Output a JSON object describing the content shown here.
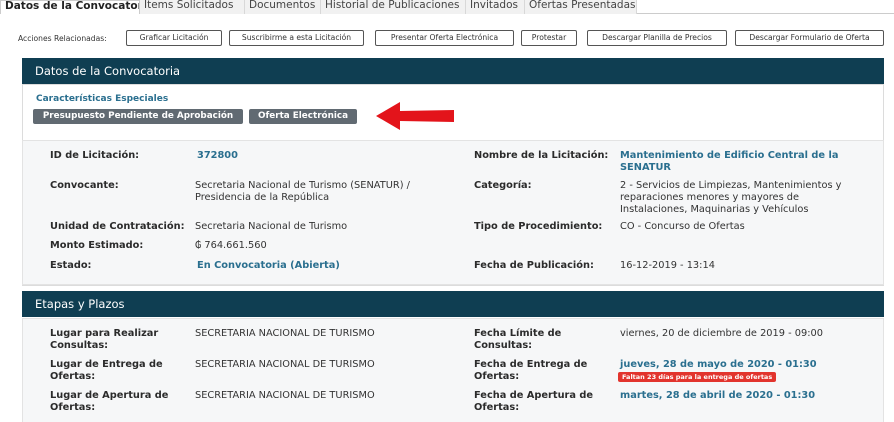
{
  "tabs": [
    {
      "label": "Datos de la Convocatoria",
      "active": true
    },
    {
      "label": "Ítems Solicitados"
    },
    {
      "label": "Documentos"
    },
    {
      "label": "Historial de Publicaciones"
    },
    {
      "label": "Invitados"
    },
    {
      "label": "Ofertas Presentadas"
    }
  ],
  "actions": {
    "label": "Acciones Relacionadas:",
    "buttons": [
      "Graficar Licitación",
      "Suscribirme a esta Licitación",
      "Presentar Oferta Electrónica",
      "Protestar",
      "Descargar Planilla de Precios",
      "Descargar Formulario de Oferta"
    ]
  },
  "convocatoria": {
    "header": "Datos de la Convocatoria",
    "special_title": "Características Especiales",
    "badges": [
      "Presupuesto Pendiente de Aprobación",
      "Oferta Electrónica"
    ],
    "arrow_color": "#e3141b"
  },
  "info": {
    "id_label": "ID de Licitación:",
    "id_value": "372800",
    "nombre_label": "Nombre de la Licitación:",
    "nombre_value_1": "Mantenimiento de Edificio Central de la",
    "nombre_value_2": "SENATUR",
    "convocante_label": "Convocante:",
    "convocante_value_1": "Secretaria Nacional de Turismo (SENATUR) /",
    "convocante_value_2": "Presidencia de la República",
    "categoria_label": "Categoría:",
    "categoria_value_1": "2 - Servicios de Limpiezas, Mantenimientos y",
    "categoria_value_2": "reparaciones menores y mayores de",
    "categoria_value_3": "Instalaciones, Maquinarias y Vehículos",
    "unidad_label": "Unidad de Contratación:",
    "unidad_value": "Secretaria Nacional de Turismo",
    "tipo_label": "Tipo de Procedimiento:",
    "tipo_value": "CO - Concurso de Ofertas",
    "monto_label": "Monto Estimado:",
    "monto_value": "₲ 764.661.560",
    "estado_label": "Estado:",
    "estado_value": "En Convocatoria (Abierta)",
    "fecha_pub_label": "Fecha de Publicación:",
    "fecha_pub_value": "16-12-2019 - 13:14"
  },
  "etapas": {
    "header": "Etapas y Plazos",
    "consultas_label_1": "Lugar para Realizar",
    "consultas_label_2": "Consultas:",
    "consultas_value": "SECRETARIA NACIONAL DE TURISMO",
    "limite_label_1": "Fecha Límite de",
    "limite_label_2": "Consultas:",
    "limite_value": "viernes, 20 de diciembre de 2019 - 09:00",
    "entrega_lugar_label_1": "Lugar de Entrega de",
    "entrega_lugar_label_2": "Ofertas:",
    "entrega_lugar_value": "SECRETARIA NACIONAL DE TURISMO",
    "entrega_fecha_label_1": "Fecha de Entrega de",
    "entrega_fecha_label_2": "Ofertas:",
    "entrega_fecha_value": "jueves, 28 de mayo de 2020 - 01:30",
    "entrega_tag": "Faltan 23 días para la entrega de ofertas",
    "apertura_lugar_label_1": "Lugar de Apertura de",
    "apertura_lugar_label_2": "Ofertas:",
    "apertura_lugar_value": "SECRETARIA NACIONAL DE TURISMO",
    "apertura_fecha_label_1": "Fecha de Apertura de",
    "apertura_fecha_label_2": "Ofertas:",
    "apertura_fecha_value": "martes, 28 de abril de 2020 - 01:30"
  }
}
